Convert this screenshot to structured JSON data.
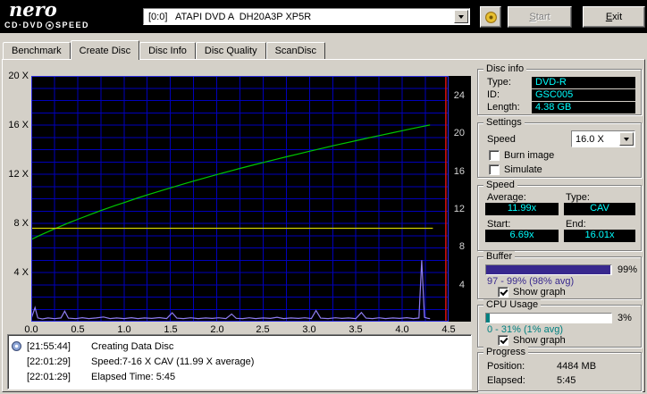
{
  "brand": {
    "name": "nero",
    "product_left": "CD·DVD",
    "product_right": "SPEED"
  },
  "theme": {
    "window_bg": "#d4d0c8",
    "value_text": "#00ffff"
  },
  "toolbar": {
    "drive": "[0:0]   ATAPI DVD A  DH20A3P XP5R",
    "start_key": "S",
    "start_rest": "tart",
    "exit_key": "E",
    "exit_rest": "xit"
  },
  "tabs": [
    {
      "label": "Benchmark"
    },
    {
      "label": "Create Disc"
    },
    {
      "label": "Disc Info"
    },
    {
      "label": "Disc Quality"
    },
    {
      "label": "ScanDisc"
    }
  ],
  "chart_data": {
    "type": "line",
    "x_axis": {
      "ticks": [
        "0.0",
        "0.5",
        "1.0",
        "1.5",
        "2.0",
        "2.5",
        "3.0",
        "3.5",
        "4.0",
        "4.5"
      ],
      "range": [
        0,
        4.5
      ],
      "grid_step": 0.25
    },
    "y_left": {
      "ticks": [
        "20 X",
        "16 X",
        "12 X",
        "8 X",
        "4 X"
      ],
      "range": [
        0,
        20
      ],
      "grid_step": 1
    },
    "y_right": {
      "ticks": [
        "24",
        "20",
        "16",
        "12",
        "8",
        "4"
      ],
      "range": [
        0,
        26
      ]
    },
    "bg_color": "#000000",
    "grid_color": "#0000bb",
    "border_color": "#2d2de0",
    "series": [
      {
        "name": "write-speed",
        "color": "#00c800",
        "x": [
          0,
          0.1,
          0.25,
          0.4,
          0.5,
          0.65,
          0.75,
          0.9,
          1.0,
          1.15,
          1.25,
          1.4,
          1.5,
          1.65,
          1.75,
          1.9,
          2.0,
          2.15,
          2.25,
          2.4,
          2.5,
          2.65,
          2.75,
          2.9,
          3.0,
          3.15,
          3.25,
          3.4,
          3.5,
          3.65,
          3.75,
          3.9,
          4.0,
          4.1,
          4.2,
          4.3
        ],
        "y": [
          6.69,
          7.05,
          7.55,
          8.03,
          8.33,
          8.76,
          9.04,
          9.44,
          9.69,
          10.07,
          10.31,
          10.66,
          10.89,
          11.22,
          11.44,
          11.76,
          11.97,
          12.27,
          12.47,
          12.76,
          12.95,
          13.23,
          13.42,
          13.69,
          13.87,
          14.13,
          14.31,
          14.56,
          14.73,
          14.98,
          15.14,
          15.38,
          15.54,
          15.7,
          15.86,
          16.01
        ]
      },
      {
        "name": "rotation-speed",
        "color": "#d0d000",
        "x": [
          0,
          4.33
        ],
        "y": [
          7.6,
          7.6
        ]
      },
      {
        "name": "activity-graph",
        "color": "#8f7df2",
        "x": [
          0.0,
          0.04,
          0.07,
          0.12,
          0.18,
          0.25,
          0.32,
          0.36,
          0.4,
          0.48,
          0.55,
          0.62,
          0.7,
          0.78,
          0.85,
          0.92,
          1.0,
          1.08,
          1.15,
          1.22,
          1.3,
          1.38,
          1.46,
          1.52,
          1.57,
          1.64,
          1.72,
          1.8,
          1.88,
          1.95,
          2.02,
          2.1,
          2.16,
          2.21,
          2.28,
          2.35,
          2.42,
          2.5,
          2.58,
          2.65,
          2.72,
          2.8,
          2.88,
          2.95,
          3.02,
          3.07,
          3.12,
          3.2,
          3.28,
          3.35,
          3.42,
          3.5,
          3.56,
          3.61,
          3.68,
          3.75,
          3.82,
          3.9,
          3.97,
          4.05,
          4.12,
          4.18,
          4.21,
          4.24,
          4.28,
          4.3
        ],
        "y": [
          0.25,
          1.15,
          0.3,
          0.22,
          0.3,
          0.24,
          0.3,
          0.85,
          0.28,
          0.24,
          0.32,
          0.25,
          0.3,
          0.38,
          0.25,
          0.3,
          0.25,
          0.32,
          0.25,
          0.3,
          0.26,
          0.33,
          0.25,
          0.72,
          0.28,
          0.25,
          0.31,
          0.25,
          0.3,
          0.26,
          0.31,
          0.25,
          0.62,
          0.27,
          0.25,
          0.31,
          0.25,
          0.3,
          0.26,
          0.36,
          0.25,
          0.3,
          0.26,
          0.31,
          0.25,
          0.9,
          0.28,
          0.25,
          0.31,
          0.26,
          0.3,
          0.25,
          0.74,
          0.28,
          0.25,
          0.31,
          0.25,
          0.3,
          0.26,
          0.32,
          0.25,
          0.3,
          5.0,
          0.35,
          0.26,
          0.25
        ]
      }
    ],
    "markers": [
      {
        "type": "vline",
        "x": 4.47,
        "color": "#dd1111"
      }
    ]
  },
  "disc_info": {
    "title": "Disc info",
    "type_label": "Type:",
    "type_value": "DVD-R",
    "id_label": "ID:",
    "id_value": "GSC005",
    "length_label": "Length:",
    "length_value": "4.38 GB"
  },
  "settings": {
    "title": "Settings",
    "speed_label": "Speed",
    "speed_value": "16.0 X",
    "burn_image_label": "Burn image",
    "burn_image_checked": false,
    "simulate_label": "Simulate",
    "simulate_checked": false
  },
  "speed": {
    "title": "Speed",
    "average_label": "Average:",
    "average_value": "11.99x",
    "type_label": "Type:",
    "type_value": "CAV",
    "start_label": "Start:",
    "start_value": "6.69x",
    "end_label": "End:",
    "end_value": "16.01x"
  },
  "buffer": {
    "title": "Buffer",
    "percent": "99%",
    "fill_pct": 99,
    "color": "#38288e",
    "range_text": "97 - 99% (98% avg)",
    "show_graph_label": "Show graph",
    "show_graph_checked": true
  },
  "cpu": {
    "title": "CPU Usage",
    "percent": "3%",
    "fill_pct": 3,
    "color": "#008080",
    "range_text": "0 - 31% (1% avg)",
    "show_graph_label": "Show graph",
    "show_graph_checked": true
  },
  "progress": {
    "title": "Progress",
    "position_label": "Position:",
    "position_value": "4484 MB",
    "elapsed_label": "Elapsed:",
    "elapsed_value": "5:45"
  },
  "log": {
    "entries": [
      {
        "time": "[21:55:44]",
        "text": "Creating Data Disc"
      },
      {
        "time": "[22:01:29]",
        "text": "Speed:7-16 X CAV (11.99 X average)"
      },
      {
        "time": "[22:01:29]",
        "text": "Elapsed Time: 5:45"
      }
    ]
  }
}
